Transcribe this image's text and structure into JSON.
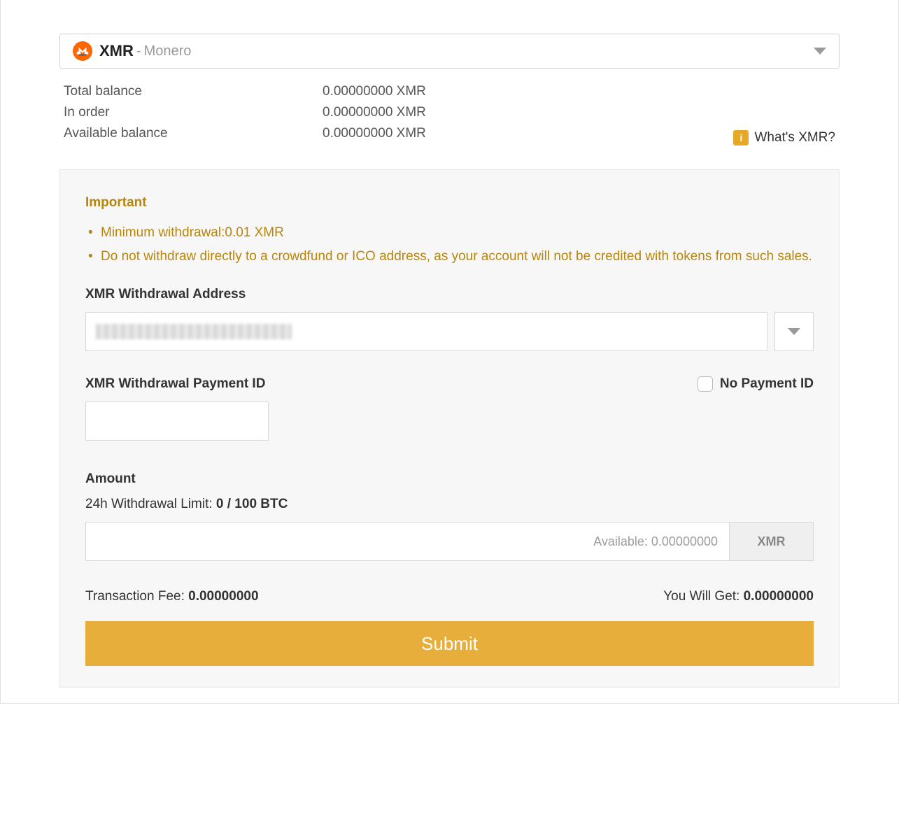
{
  "currency": {
    "symbol": "XMR",
    "name": "Monero",
    "sep": " - "
  },
  "balances": {
    "total_label": "Total balance",
    "total_value": "0.00000000 XMR",
    "in_order_label": "In order",
    "in_order_value": "0.00000000 XMR",
    "available_label": "Available balance",
    "available_value": "0.00000000 XMR"
  },
  "whats_link": "What's XMR?",
  "important": {
    "title": "Important",
    "items": [
      "Minimum withdrawal:0.01 XMR",
      "Do not withdraw directly to a crowdfund or ICO address, as your account will not be credited with tokens from such sales."
    ]
  },
  "address": {
    "label": "XMR Withdrawal Address",
    "value": ""
  },
  "payment_id": {
    "label": "XMR Withdrawal Payment ID",
    "checkbox_label": "No Payment ID",
    "value": ""
  },
  "amount": {
    "label": "Amount",
    "limit_prefix": "24h Withdrawal Limit: ",
    "limit_value": "0 / 100 BTC",
    "placeholder": "Available: 0.00000000",
    "unit": "XMR"
  },
  "fee": {
    "fee_label": "Transaction Fee: ",
    "fee_value": "0.00000000",
    "get_label": "You Will Get: ",
    "get_value": "0.00000000"
  },
  "submit_label": "Submit"
}
